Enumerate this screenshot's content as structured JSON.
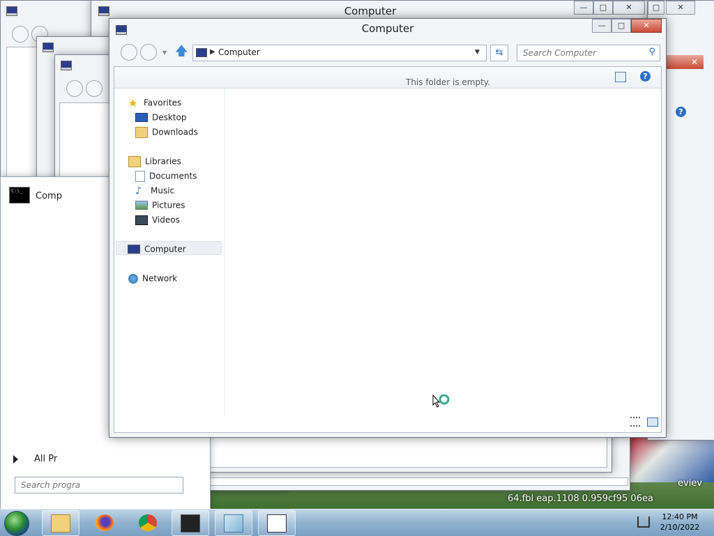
{
  "main_window": {
    "title": "Computer",
    "buttons": {
      "minimize": "—",
      "maximize": "□",
      "close": "✕"
    },
    "address": {
      "crumb": "Computer"
    },
    "search": {
      "placeholder": "Search Computer"
    },
    "empty_message": "This folder is empty.",
    "nav": {
      "favorites": "Favorites",
      "desktop": "Desktop",
      "downloads": "Downloads",
      "libraries": "Libraries",
      "documents": "Documents",
      "music": "Music",
      "pictures": "Pictures",
      "videos": "Videos",
      "computer": "Computer",
      "network": "Network"
    }
  },
  "back_window": {
    "title": "Computer"
  },
  "start_menu": {
    "item_label": "Comp",
    "all_programs": "All Pr",
    "search_placeholder": "Search progra"
  },
  "desktop": {
    "file_text": "64.fbl  eap.1108  0.959cf95  06ea",
    "side_text": "eviev"
  },
  "taskbar": {
    "time": "12:40 PM",
    "date": "2/10/2022",
    "apps": [
      "start-orb",
      "windows-explorer",
      "firefox",
      "chrome",
      "dosbox",
      "notepad",
      "calculator-window"
    ]
  },
  "colors": {
    "accent": "#2e6fc8",
    "close_red": "#c94a36",
    "taskbar": "#8fb2cf"
  }
}
